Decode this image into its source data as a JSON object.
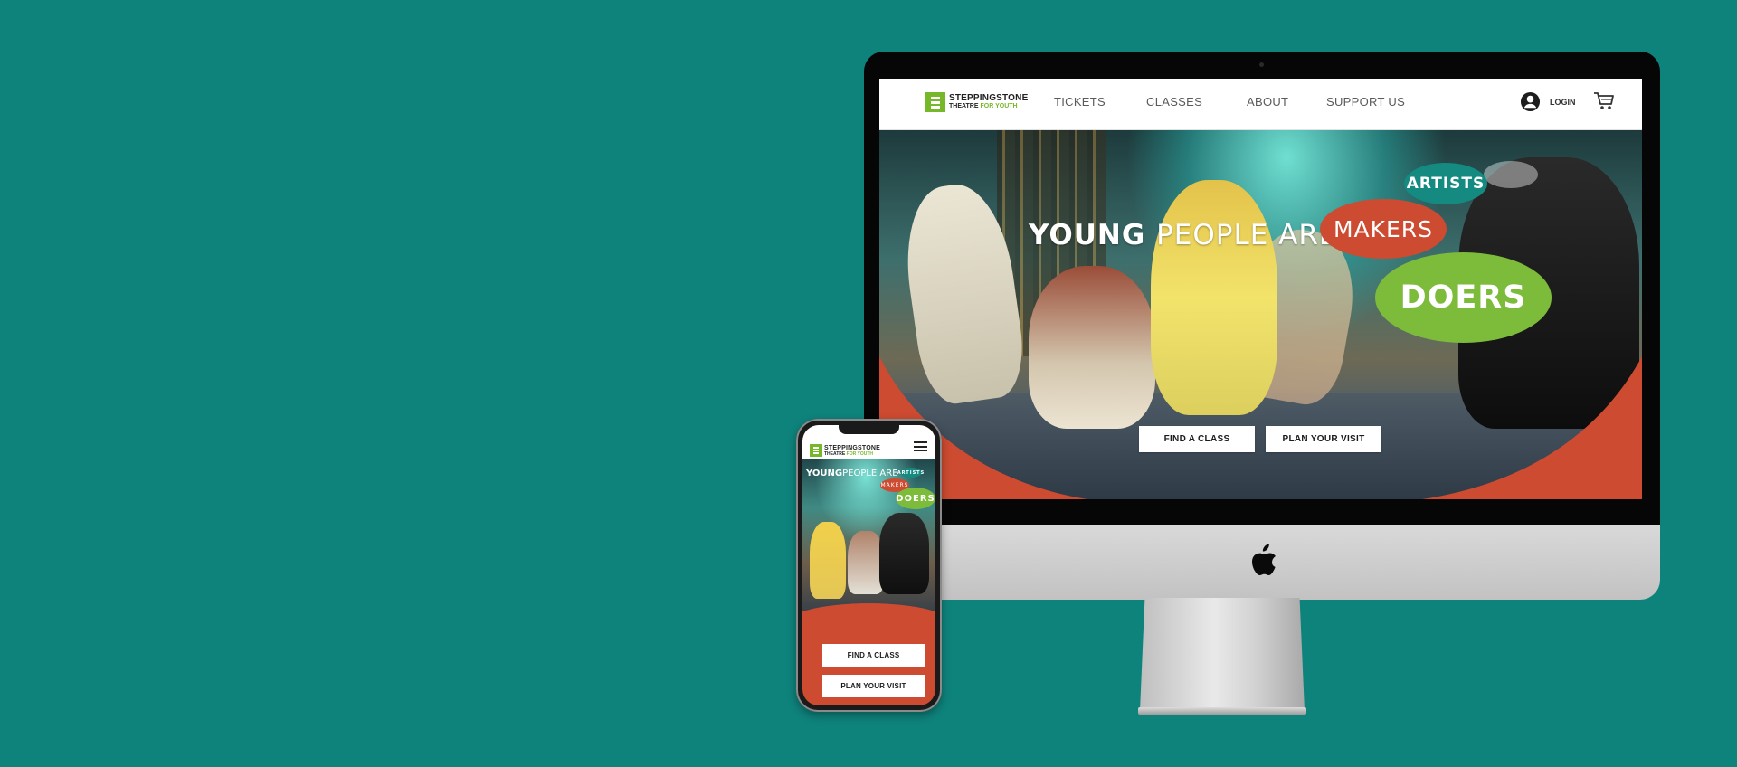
{
  "colors": {
    "background": "#0e837c",
    "accent_red": "#cd4b31",
    "accent_green": "#7dbb3b",
    "accent_teal": "#148a80"
  },
  "desktop": {
    "logo": {
      "line1": "STEPPINGSTONE",
      "line2_a": "THEATRE",
      "line2_b": "FOR YOUTH"
    },
    "nav": [
      "TICKETS",
      "CLASSES",
      "ABOUT",
      "SUPPORT US"
    ],
    "login_label": "LOGIN",
    "icons": [
      "user-icon",
      "cart-icon"
    ],
    "hero": {
      "headline_bold": "YOUNG",
      "headline_rest": "PEOPLE ARE",
      "bubbles": [
        "ARTISTS",
        "MAKERS",
        "DOERS"
      ],
      "buttons": [
        "FIND A CLASS",
        "PLAN YOUR VISIT"
      ]
    }
  },
  "mobile": {
    "logo": {
      "line1": "STEPPINGSTONE",
      "line2_a": "THEATRE",
      "line2_b": "FOR YOUTH"
    },
    "icons": [
      "hamburger-menu-icon"
    ],
    "hero": {
      "headline_bold": "YOUNG",
      "headline_rest": "PEOPLE ARE",
      "bubbles": [
        "ARTISTS",
        "MAKERS",
        "DOERS"
      ]
    },
    "buttons": [
      "FIND A CLASS",
      "PLAN YOUR VISIT"
    ]
  }
}
